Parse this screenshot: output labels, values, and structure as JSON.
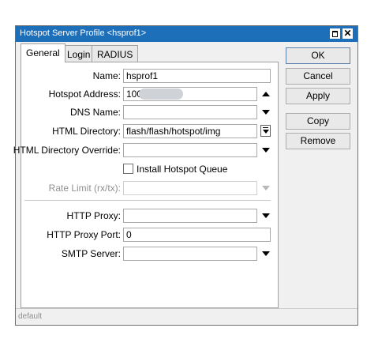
{
  "window": {
    "title": "Hotspot Server Profile <hsprof1>",
    "titlebar_color": "#1e6fba",
    "controls": [
      "maximize-icon",
      "close-icon"
    ],
    "close_glyph": "✕"
  },
  "tabs": [
    {
      "label": "General",
      "active": true
    },
    {
      "label": "Login",
      "active": false
    },
    {
      "label": "RADIUS",
      "active": false
    }
  ],
  "fields": {
    "name": {
      "label": "Name:",
      "value": "hsprof1"
    },
    "hotspot_address": {
      "label": "Hotspot Address:",
      "value": "100"
    },
    "dns_name": {
      "label": "DNS Name:",
      "value": ""
    },
    "html_directory": {
      "label": "HTML Directory:",
      "value": "flash/flash/hotspot/img"
    },
    "html_directory_override": {
      "label": "HTML Directory Override:",
      "value": ""
    },
    "install_hotspot_queue": {
      "label": "Install Hotspot Queue",
      "checked": false
    },
    "rate_limit": {
      "label": "Rate Limit (rx/tx):",
      "value": "",
      "disabled": true
    },
    "http_proxy": {
      "label": "HTTP Proxy:",
      "value": ""
    },
    "http_proxy_port": {
      "label": "HTTP Proxy Port:",
      "value": "0"
    },
    "smtp_server": {
      "label": "SMTP Server:",
      "value": ""
    }
  },
  "buttons": {
    "ok": "OK",
    "cancel": "Cancel",
    "apply": "Apply",
    "copy": "Copy",
    "remove": "Remove"
  },
  "status": {
    "text": "default"
  }
}
